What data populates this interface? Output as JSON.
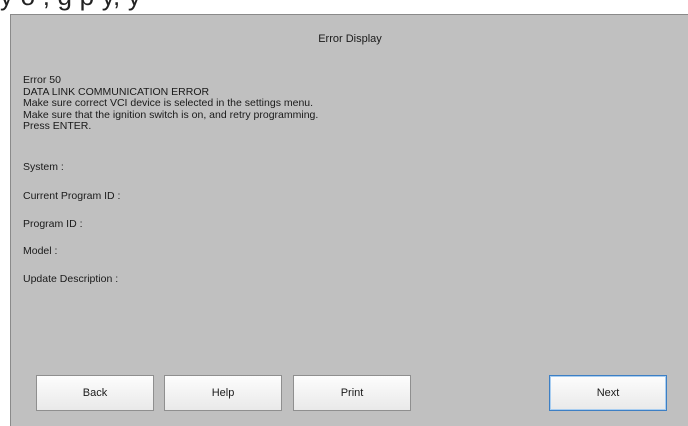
{
  "header_fragment": "y     o     ,          g           p   y,               y",
  "window": {
    "title": "Error Display"
  },
  "message": {
    "lines": [
      "Error 50",
      "DATA LINK COMMUNICATION ERROR",
      "Make sure correct VCI device is selected in the settings menu.",
      "Make sure that the ignition switch is on, and retry programming.",
      "Press ENTER."
    ]
  },
  "fields": {
    "system": "System :",
    "current_program_id": "Current Program ID :",
    "program_id": "Program ID :",
    "model": "Model :",
    "update_description": "Update Description :"
  },
  "buttons": {
    "back": "Back",
    "help": "Help",
    "print": "Print",
    "next": "Next"
  },
  "colors": {
    "window_bg": "#c0c0c0",
    "button_bg": "#f2f2f2",
    "next_border": "#3d7fc4"
  }
}
